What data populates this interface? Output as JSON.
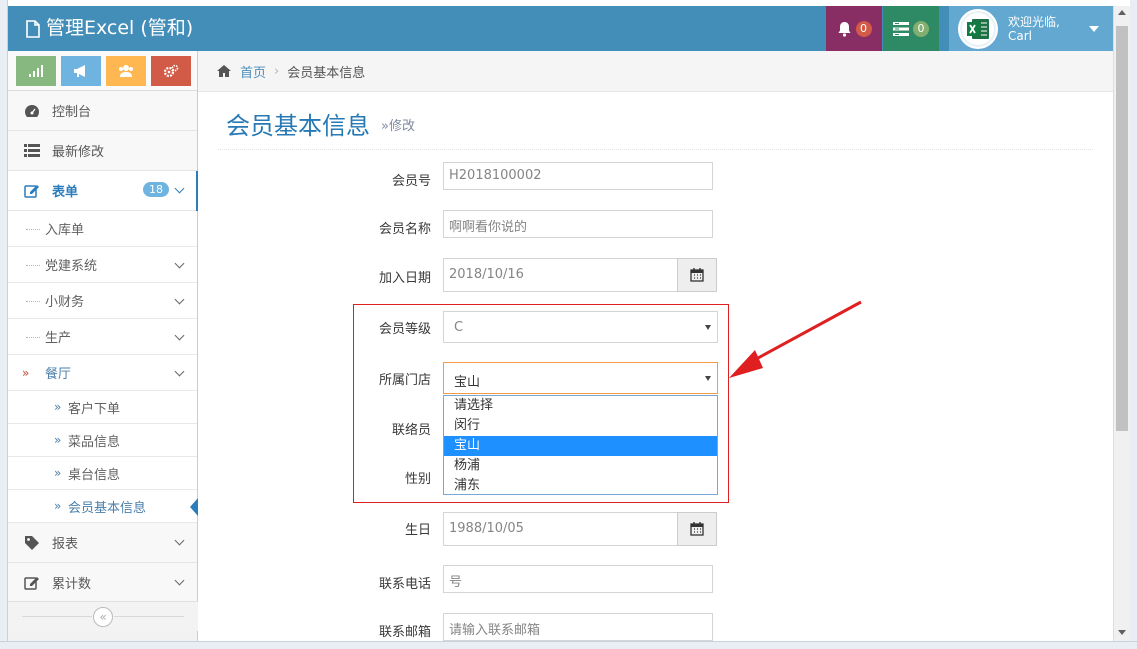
{
  "navbar": {
    "brand": "管理Excel (管和)",
    "notifications_count": "0",
    "tasks_count": "0",
    "welcome": "欢迎光临,",
    "user_name": "Carl"
  },
  "sidebar": {
    "items": [
      {
        "label": "控制台"
      },
      {
        "label": "最新修改"
      },
      {
        "label": "表单",
        "count": "18"
      },
      {
        "label": "报表"
      },
      {
        "label": "累计数"
      }
    ],
    "form_sub": [
      {
        "label": "入库单"
      },
      {
        "label": "党建系统"
      },
      {
        "label": "小财务"
      },
      {
        "label": "生产"
      },
      {
        "label": "餐厅"
      }
    ],
    "restaurant_sub": [
      {
        "label": "客户下单"
      },
      {
        "label": "菜品信息"
      },
      {
        "label": "桌台信息"
      },
      {
        "label": "会员基本信息"
      }
    ],
    "collapse_glyph": "«"
  },
  "breadcrumbs": {
    "home": "首页",
    "separator": "›",
    "current": "会员基本信息"
  },
  "page": {
    "title": "会员基本信息",
    "subtitle": "»修改"
  },
  "form": {
    "member_no": {
      "label": "会员号",
      "value": "H2018100002"
    },
    "member_name": {
      "label": "会员名称",
      "value": "啊啊看你说的"
    },
    "join_date": {
      "label": "加入日期",
      "value": "2018/10/16"
    },
    "member_level": {
      "label": "会员等级",
      "value": "C"
    },
    "store": {
      "label": "所属门店",
      "value": "宝山"
    },
    "contact": {
      "label": "联络员"
    },
    "gender": {
      "label": "性别"
    },
    "birthday": {
      "label": "生日",
      "value": "1988/10/05"
    },
    "phone": {
      "label": "联系电话",
      "value": "号"
    },
    "email": {
      "label": "联系邮箱",
      "placeholder": "请输入联系邮箱"
    }
  },
  "store_dropdown": {
    "options": [
      "请选择",
      "闵行",
      "宝山",
      "杨浦",
      "浦东"
    ],
    "selected_index": 2
  },
  "colors": {
    "navbar": "#438eb9",
    "accent": "#2679b5",
    "annotation": "#e02020"
  }
}
